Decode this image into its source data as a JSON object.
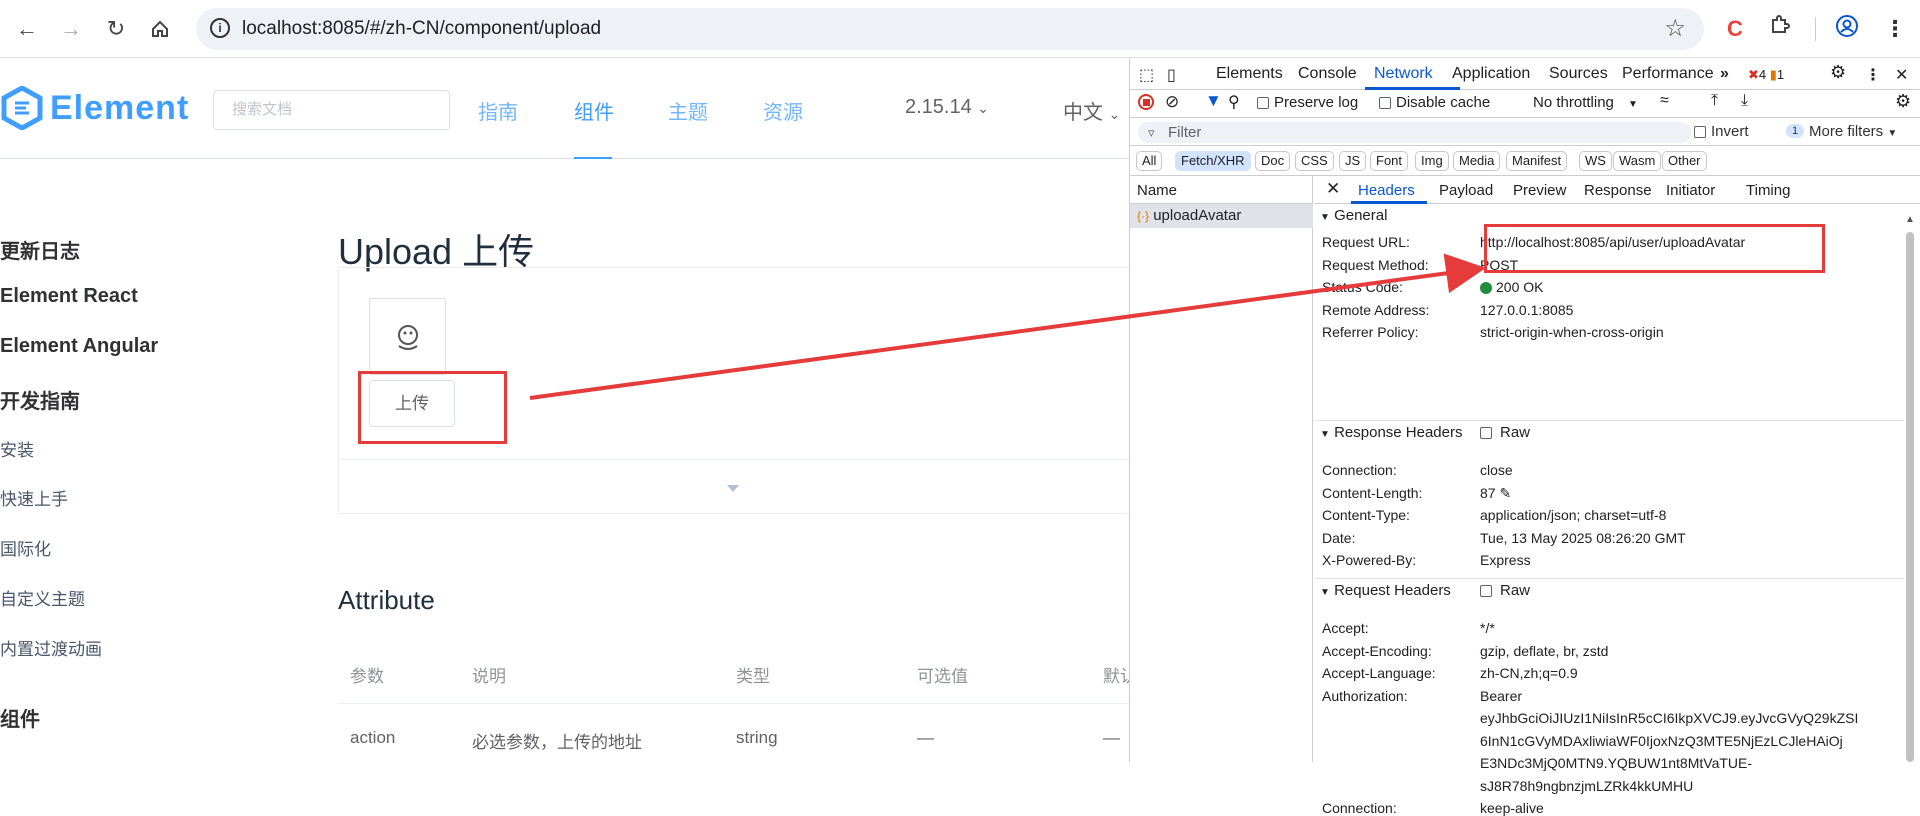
{
  "browser": {
    "url": "localhost:8085/#/zh-CN/component/upload"
  },
  "site": {
    "logo_text": "Element",
    "search_placeholder": "搜索文档",
    "nav": [
      "指南",
      "组件",
      "主题",
      "资源"
    ],
    "version": "2.15.14",
    "lang": "中文"
  },
  "sidebar": {
    "items": [
      "更新日志",
      "Element React",
      "Element Angular",
      "开发指南",
      "安装",
      "快速上手",
      "国际化",
      "自定义主题",
      "内置过渡动画",
      "组件"
    ]
  },
  "main": {
    "title": "Upload 上传",
    "upload_label": "上传",
    "attribute_title": "Attribute",
    "table_headers": [
      "参数",
      "说明",
      "类型",
      "可选值",
      "默认"
    ],
    "table_row": [
      "action",
      "必选参数，上传的地址",
      "string",
      "—",
      "—"
    ]
  },
  "devtools": {
    "tabs": [
      "Elements",
      "Console",
      "Network",
      "Application",
      "Sources",
      "Performance"
    ],
    "error_count": "4",
    "warning_count": "1",
    "preserve_log": "Preserve log",
    "disable_cache": "Disable cache",
    "throttling": "No throttling",
    "filter_placeholder": "Filter",
    "invert": "Invert",
    "more_filters_count": "1",
    "more_filters": "More filters",
    "types": [
      "All",
      "Fetch/XHR",
      "Doc",
      "CSS",
      "JS",
      "Font",
      "Img",
      "Media",
      "Manifest",
      "WS",
      "Wasm",
      "Other"
    ],
    "name_header": "Name",
    "request_name": "uploadAvatar",
    "detail_tabs": [
      "Headers",
      "Payload",
      "Preview",
      "Response",
      "Initiator",
      "Timing"
    ],
    "general_title": "General",
    "general": [
      {
        "k": "Request URL:",
        "v": "http://localhost:8085/api/user/uploadAvatar"
      },
      {
        "k": "Request Method:",
        "v": "POST"
      },
      {
        "k": "Status Code:",
        "v": "200 OK"
      },
      {
        "k": "Remote Address:",
        "v": "127.0.0.1:8085"
      },
      {
        "k": "Referrer Policy:",
        "v": "strict-origin-when-cross-origin"
      }
    ],
    "response_headers_title": "Response Headers",
    "raw_label": "Raw",
    "response_headers": [
      {
        "k": "Connection:",
        "v": "close"
      },
      {
        "k": "Content-Length:",
        "v": "87"
      },
      {
        "k": "Content-Type:",
        "v": "application/json; charset=utf-8"
      },
      {
        "k": "Date:",
        "v": "Tue, 13 May 2025 08:26:20 GMT"
      },
      {
        "k": "X-Powered-By:",
        "v": "Express"
      }
    ],
    "request_headers_title": "Request Headers",
    "request_headers": [
      {
        "k": "Accept:",
        "v": "*/*"
      },
      {
        "k": "Accept-Encoding:",
        "v": "gzip, deflate, br, zstd"
      },
      {
        "k": "Accept-Language:",
        "v": "zh-CN,zh;q=0.9"
      },
      {
        "k": "Authorization:",
        "v": "Bearer"
      },
      {
        "k": "",
        "v": "eyJhbGciOiJIUzI1NiIsInR5cCI6IkpXVCJ9.eyJvcGVyQ29kZSI"
      },
      {
        "k": "",
        "v": "6InN1cGVyMDAxliwiaWF0IjoxNzQ3MTE5NjEzLCJleHAiOj"
      },
      {
        "k": "",
        "v": "E3NDc3MjQ0MTN9.YQBUW1nt8MtVaTUE-"
      },
      {
        "k": "",
        "v": "sJ8R78h9ngbnzjmLZRk4kkUMHU"
      },
      {
        "k": "Connection:",
        "v": "keep-alive"
      }
    ]
  },
  "colors": {
    "brand": "#409eff",
    "annotation": "#e63b3b",
    "devtools_accent": "#0b57d0"
  }
}
